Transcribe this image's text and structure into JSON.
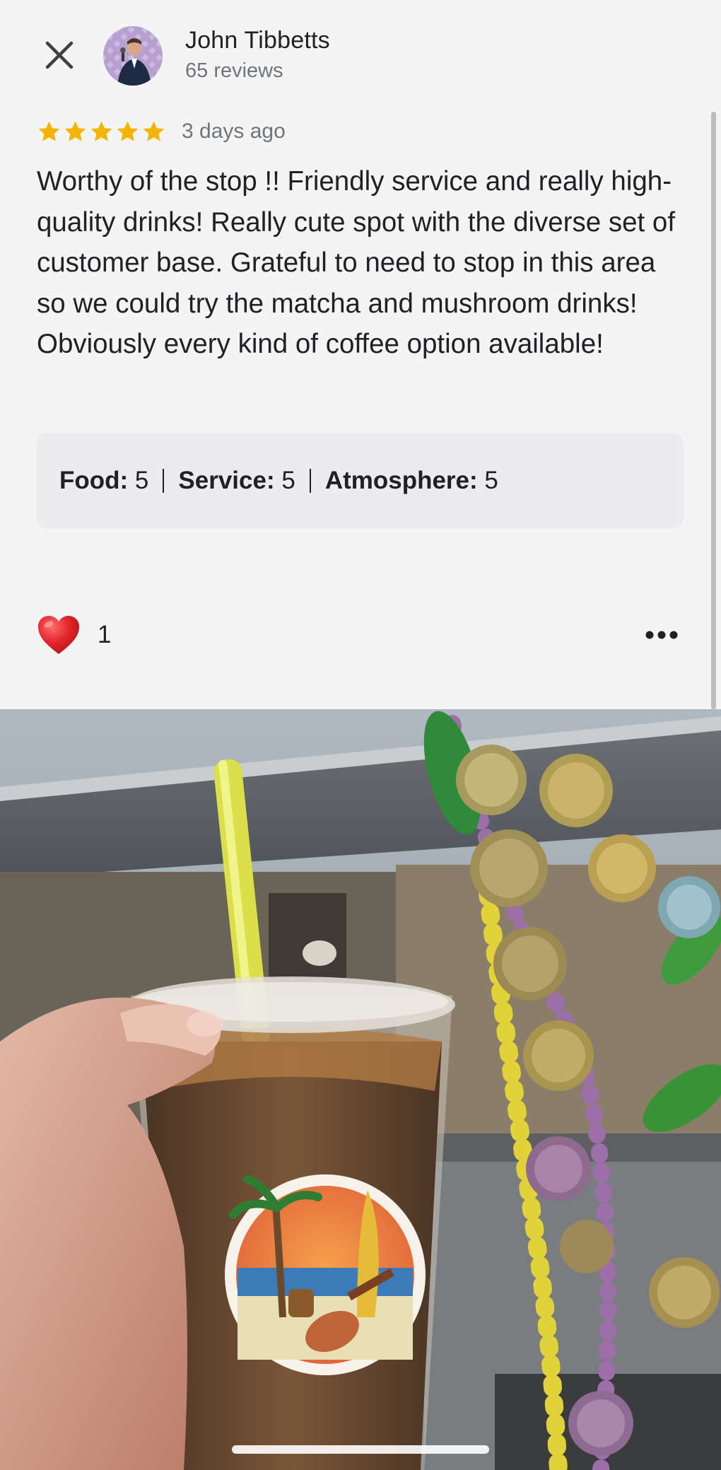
{
  "author": {
    "name": "John Tibbetts",
    "reviews": "65 reviews"
  },
  "review": {
    "rating": 5,
    "max_rating": 5,
    "date": "3 days ago",
    "text": "Worthy of the stop !! Friendly service and really high-quality drinks! Really cute spot with the diverse set of customer base. Grateful to need to stop in this area so we could try the matcha and mushroom drinks! Obviously every kind of coffee option available!",
    "subratings": [
      {
        "label": "Food:",
        "value": "5"
      },
      {
        "label": "Service:",
        "value": "5"
      },
      {
        "label": "Atmosphere:",
        "value": "5"
      }
    ]
  },
  "reactions": {
    "like_count": "1"
  },
  "icons": {
    "close": "close-icon",
    "like": "heart-icon",
    "more": "more-options-icon"
  },
  "colors": {
    "star": "#f4b400",
    "heart": "#e0242b",
    "secondary_text": "#70757a",
    "background": "#f4f4f5"
  }
}
